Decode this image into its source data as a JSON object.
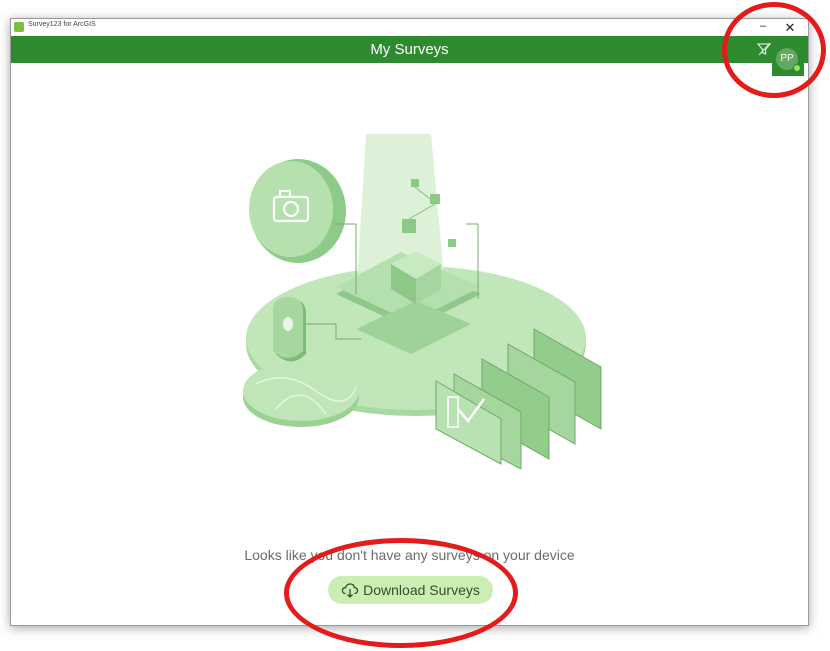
{
  "window": {
    "title": "Survey123 for ArcGIS",
    "minimize_glyph": "–",
    "close_glyph": "✕"
  },
  "appbar": {
    "title": "My Surveys",
    "filter_icon": "filter-icon"
  },
  "user": {
    "initials": "PP"
  },
  "empty_state": {
    "message": "Looks like you don't have any surveys on your device",
    "download_button_label": "Download Surveys",
    "download_icon": "cloud-download-icon"
  },
  "colors": {
    "appbar": "#2d8a2e",
    "button_bg": "#cdeeb3",
    "annotation": "#e31b1b"
  }
}
